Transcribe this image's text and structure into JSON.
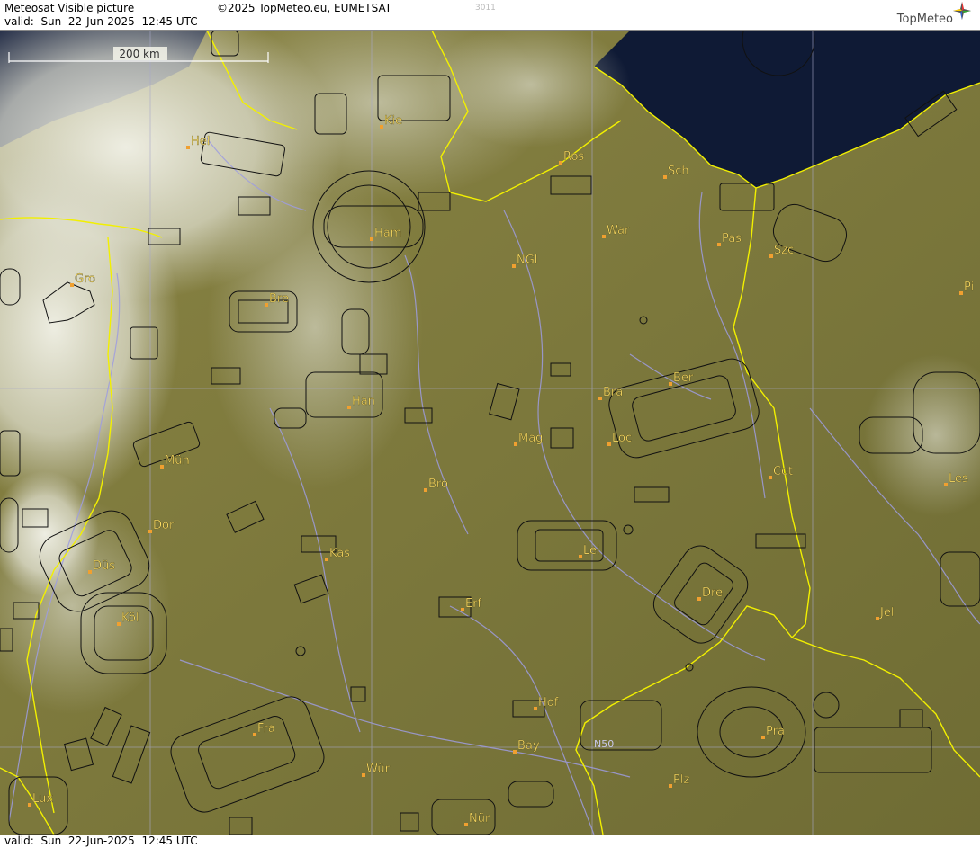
{
  "header": {
    "title": "Meteosat Visible picture",
    "copyright": "©2025 TopMeteo.eu, EUMETSAT",
    "product_code": "3011",
    "valid_label": "valid:",
    "valid_day": "Sun",
    "valid_date": "22-Jun-2025",
    "valid_time": "12:45 UTC",
    "logo_text": "TopMeteo"
  },
  "footer": {
    "valid_label": "valid:",
    "valid_day": "Sun",
    "valid_date": "22-Jun-2025",
    "valid_time": "12:45 UTC"
  },
  "scale_bar": {
    "label": "200 km"
  },
  "grid_label": "N50",
  "colors": {
    "land": "#7e7a3c",
    "sea": "#0f1a35",
    "border": "#f2f000",
    "rivers": "#9e9ce0",
    "airspace": "#111111",
    "city_dot": "#f0a030",
    "city_label": "#ffe066"
  },
  "cities": [
    {
      "code": "Kie"
    },
    {
      "code": "Hel"
    },
    {
      "code": "Ros"
    },
    {
      "code": "Sch"
    },
    {
      "code": "Ham"
    },
    {
      "code": "War"
    },
    {
      "code": "Pas"
    },
    {
      "code": "Szc"
    },
    {
      "code": "NGl"
    },
    {
      "code": "Gro"
    },
    {
      "code": "Bre"
    },
    {
      "code": "Pi"
    },
    {
      "code": "Ber"
    },
    {
      "code": "Bra"
    },
    {
      "code": "Han"
    },
    {
      "code": "Loc"
    },
    {
      "code": "Mag"
    },
    {
      "code": "Mün"
    },
    {
      "code": "Cot"
    },
    {
      "code": "Bro"
    },
    {
      "code": "Les"
    },
    {
      "code": "Dor"
    },
    {
      "code": "Kas"
    },
    {
      "code": "Lei"
    },
    {
      "code": "Düs"
    },
    {
      "code": "Dre"
    },
    {
      "code": "Erf"
    },
    {
      "code": "Jel"
    },
    {
      "code": "Köl"
    },
    {
      "code": "Hof"
    },
    {
      "code": "Fra"
    },
    {
      "code": "Pra"
    },
    {
      "code": "Bay"
    },
    {
      "code": "Wür"
    },
    {
      "code": "Plz"
    },
    {
      "code": "Lux"
    },
    {
      "code": "Nür"
    }
  ]
}
